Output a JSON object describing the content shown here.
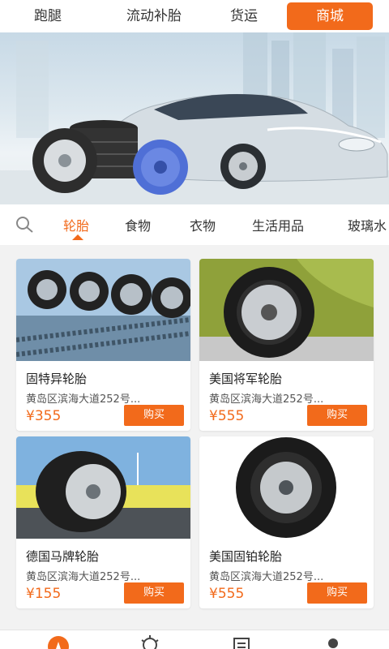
{
  "top_tabs": [
    {
      "label": "跑腿"
    },
    {
      "label": "流动补胎"
    },
    {
      "label": "货运"
    },
    {
      "label": "商城"
    }
  ],
  "categories": [
    {
      "label": "轮胎"
    },
    {
      "label": "食物"
    },
    {
      "label": "衣物"
    },
    {
      "label": "生活用品"
    },
    {
      "label": "玻璃水"
    }
  ],
  "products": [
    {
      "name": "固特异轮胎",
      "address": "黄岛区滨海大道252号...",
      "price": "¥355",
      "buy_label": "购买"
    },
    {
      "name": "美国将军轮胎",
      "address": "黄岛区滨海大道252号...",
      "price": "¥555",
      "buy_label": "购买"
    },
    {
      "name": "德国马牌轮胎",
      "address": "黄岛区滨海大道252号...",
      "price": "¥155",
      "buy_label": "购买"
    },
    {
      "name": "美国固铂轮胎",
      "address": "黄岛区滨海大道252号...",
      "price": "¥555",
      "buy_label": "购买"
    }
  ],
  "bottom_nav_icons": [
    "compass-icon",
    "lightbulb-icon",
    "document-icon",
    "profile-icon"
  ],
  "colors": {
    "accent": "#f26a1b",
    "background": "#f2f2f2"
  }
}
